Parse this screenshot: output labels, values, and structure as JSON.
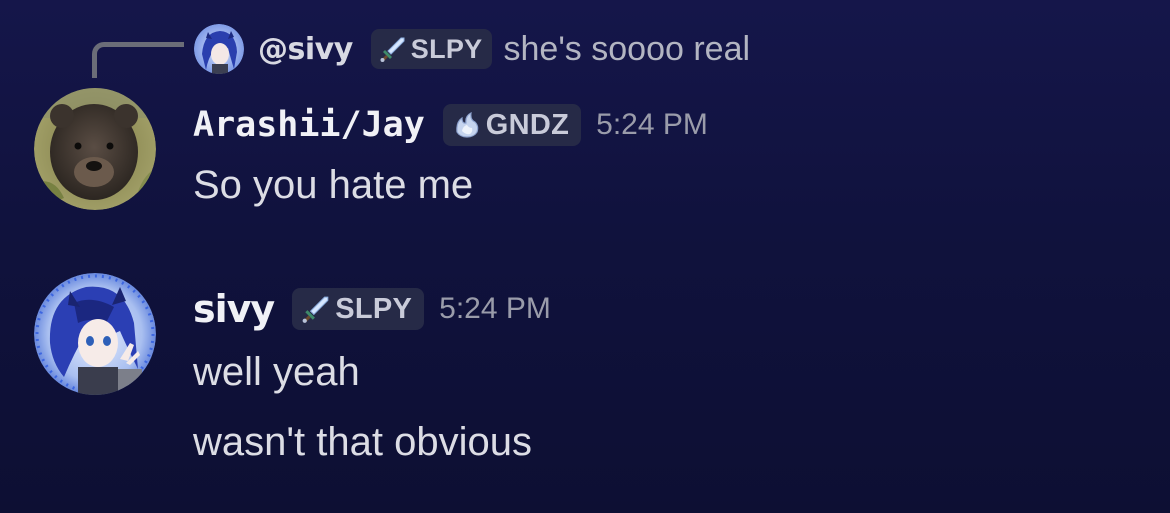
{
  "reply": {
    "username": "@sivy",
    "tag_label": "SLPY",
    "tag_icon": "sword-icon",
    "text": "she's soooo real"
  },
  "messages": [
    {
      "username": "Arashii/Jay",
      "tag_label": "GNDZ",
      "tag_icon": "flame-icon",
      "timestamp": "5:24 PM",
      "lines": [
        "So you hate me"
      ]
    },
    {
      "username": "sivy",
      "tag_label": "SLPY",
      "tag_icon": "sword-icon",
      "timestamp": "5:24 PM",
      "lines": [
        "well yeah",
        "wasn't that obvious"
      ]
    }
  ],
  "colors": {
    "background_top": "#15164a",
    "background_bottom": "#0d0f33",
    "tag_background": "#262a47",
    "reply_spine": "#6b6d78"
  }
}
